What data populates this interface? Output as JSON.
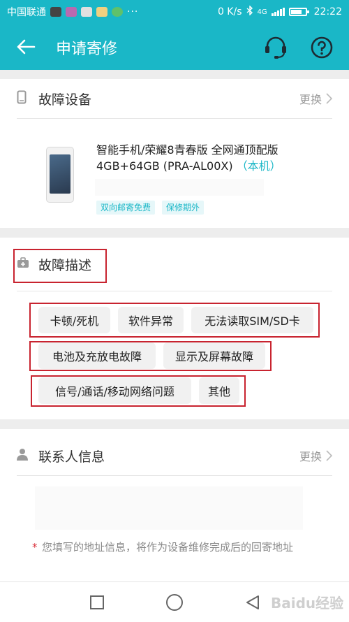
{
  "status_bar": {
    "carrier": "中国联通",
    "dots": "···",
    "speed": "0 K/s",
    "network": "4G",
    "time": "22:22"
  },
  "header": {
    "title": "申请寄修",
    "back_icon": "back-arrow-icon",
    "support_icon": "customer-service-headset-icon",
    "help_icon": "help-question-icon",
    "background_color": "#1ab7c7"
  },
  "device_section": {
    "title": "故障设备",
    "change_label": "更换",
    "icon": "phone-icon",
    "device_name": "智能手机/荣耀8青春版 全网通顶配版 4GB+64GB (PRA-AL00X)",
    "device_self_label": "（本机）",
    "tags": [
      "双向邮寄免费",
      "保修期外"
    ]
  },
  "fault_section": {
    "title": "故障描述",
    "icon": "toolbox-icon",
    "options": [
      "卡顿/死机",
      "软件异常",
      "无法读取SIM/SD卡",
      "电池及充放电故障",
      "显示及屏幕故障",
      "信号/通话/移动网络问题",
      "其他"
    ]
  },
  "contact_section": {
    "title": "联系人信息",
    "change_label": "更换",
    "icon": "person-icon",
    "note_star": "*",
    "note": "您填写的地址信息，将作为设备维修完成后的回寄地址"
  },
  "watermark": "Baidu经验",
  "colors": {
    "accent": "#1ab7c7",
    "highlight_box": "#c8232f"
  }
}
